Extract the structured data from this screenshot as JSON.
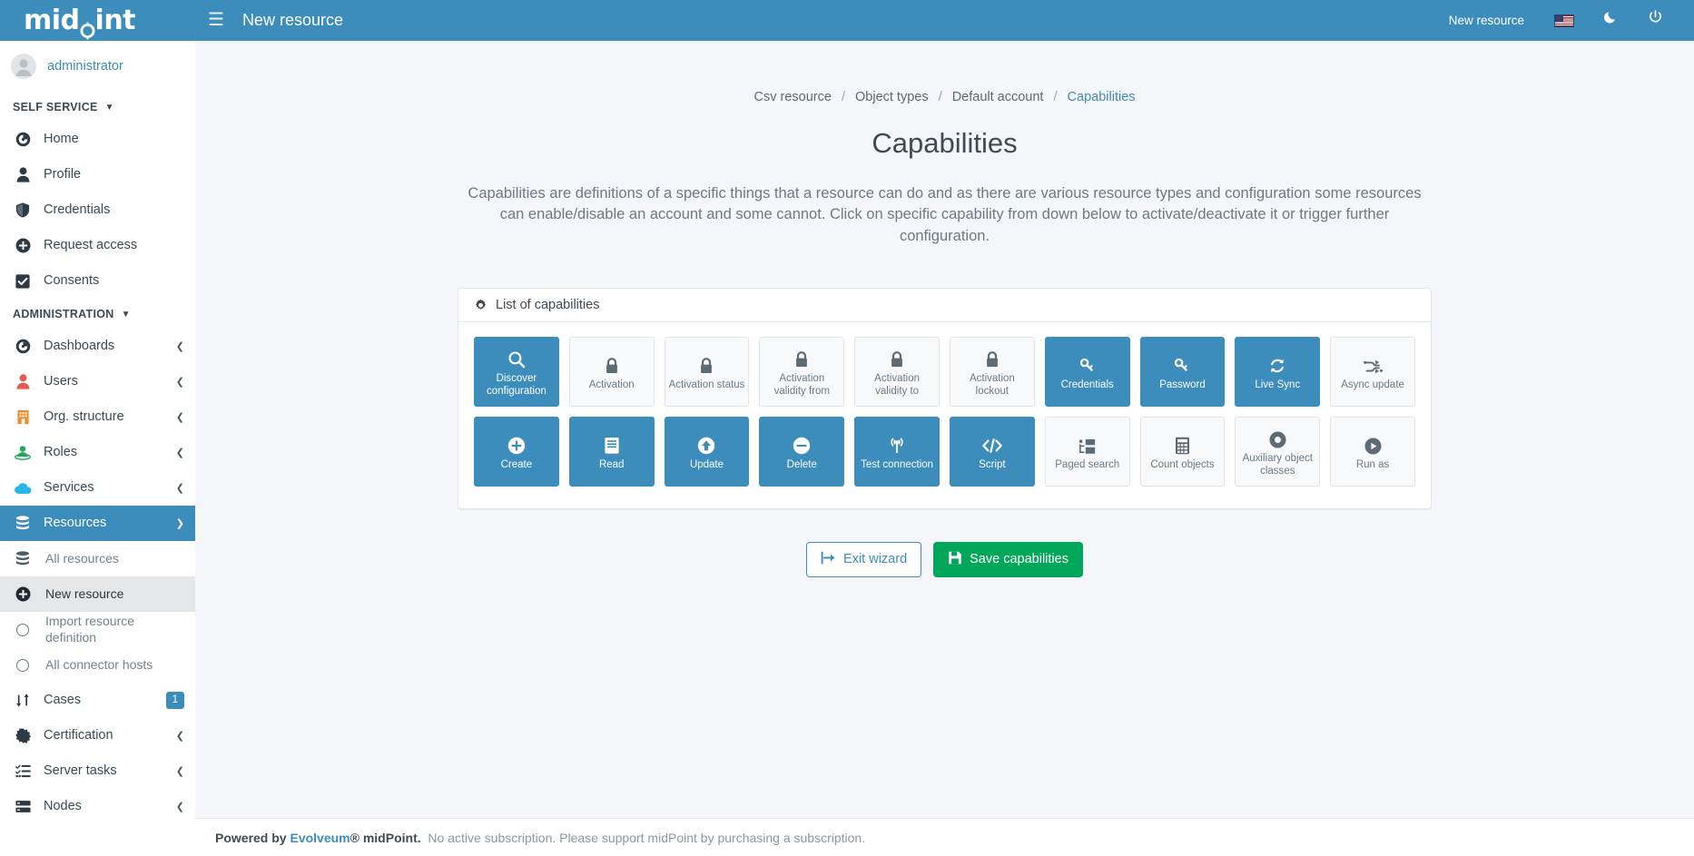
{
  "topbar": {
    "logo_prefix": "mid",
    "logo_p": "P",
    "logo_suffix": "int",
    "hamburger_icon": "hamburger-icon",
    "title": "New resource",
    "right_label": "New resource",
    "flag_icon": "us-flag-icon",
    "theme_icon": "moon-icon",
    "power_icon": "power-icon"
  },
  "sidebar": {
    "user": {
      "name": "administrator",
      "avatar_icon": "user-avatar-icon"
    },
    "sections": [
      {
        "header": "SELF SERVICE",
        "items": [
          {
            "label": "Home",
            "icon": "dashboard-icon",
            "state": "normal"
          },
          {
            "label": "Profile",
            "icon": "person-icon",
            "state": "normal"
          },
          {
            "label": "Credentials",
            "icon": "shield-icon",
            "state": "normal"
          },
          {
            "label": "Request access",
            "icon": "plus-circle-icon",
            "state": "normal"
          },
          {
            "label": "Consents",
            "icon": "check-square-icon",
            "state": "normal"
          }
        ]
      },
      {
        "header": "ADMINISTRATION",
        "items": [
          {
            "label": "Dashboards",
            "icon": "dashboard-icon",
            "state": "normal",
            "chevron": "chevron-left-icon"
          },
          {
            "label": "Users",
            "icon": "users-icon",
            "state": "normal",
            "chevron": "chevron-left-icon"
          },
          {
            "label": "Org. structure",
            "icon": "building-icon",
            "state": "normal",
            "chevron": "chevron-left-icon"
          },
          {
            "label": "Roles",
            "icon": "roles-icon",
            "state": "normal",
            "chevron": "chevron-left-icon"
          },
          {
            "label": "Services",
            "icon": "cloud-icon",
            "state": "normal",
            "chevron": "chevron-left-icon"
          },
          {
            "label": "Resources",
            "icon": "database-icon",
            "state": "active",
            "chevron": "chevron-down-icon"
          },
          {
            "label": "All resources",
            "icon": "database-icon",
            "state": "sub"
          },
          {
            "label": "New resource",
            "icon": "plus-circle-icon",
            "state": "sub-active"
          },
          {
            "label": "Import resource definition",
            "icon": "circle-icon",
            "state": "sub"
          },
          {
            "label": "All connector hosts",
            "icon": "circle-icon",
            "state": "sub"
          },
          {
            "label": "Cases",
            "icon": "cases-icon",
            "state": "normal",
            "badge": "1"
          },
          {
            "label": "Certification",
            "icon": "certification-icon",
            "state": "normal",
            "chevron": "chevron-left-icon"
          },
          {
            "label": "Server tasks",
            "icon": "tasks-list-icon",
            "state": "normal",
            "chevron": "chevron-left-icon"
          },
          {
            "label": "Nodes",
            "icon": "server-icon",
            "state": "normal",
            "chevron": "chevron-left-icon"
          }
        ]
      }
    ]
  },
  "main": {
    "breadcrumb": [
      {
        "label": "Csv resource",
        "current": false
      },
      {
        "label": "Object types",
        "current": false
      },
      {
        "label": "Default account",
        "current": false
      },
      {
        "label": "Capabilities",
        "current": true
      }
    ],
    "breadcrumb_separator": "/",
    "title": "Capabilities",
    "description": "Capabilities are definitions of a specific things that a resource can do and as there are various resource types and configuration some resources can enable/disable an account and some cannot. Click on specific capability from down below to activate/deactivate it or trigger further configuration.",
    "card": {
      "header": "List of capabilities",
      "header_icon": "gear-icon",
      "rows": [
        [
          {
            "label": "Discover configuration",
            "icon": "search-icon",
            "enabled": true
          },
          {
            "label": "Activation",
            "icon": "lock-icon",
            "enabled": false
          },
          {
            "label": "Activation status",
            "icon": "lock-icon",
            "enabled": false
          },
          {
            "label": "Activation validity from",
            "icon": "lock-icon",
            "enabled": false
          },
          {
            "label": "Activation validity to",
            "icon": "lock-icon",
            "enabled": false
          },
          {
            "label": "Activation lockout",
            "icon": "lock-icon",
            "enabled": false
          },
          {
            "label": "Credentials",
            "icon": "key-icon",
            "enabled": true
          },
          {
            "label": "Password",
            "icon": "key-icon",
            "enabled": true
          },
          {
            "label": "Live Sync",
            "icon": "refresh-icon",
            "enabled": true
          },
          {
            "label": "Async update",
            "icon": "shuffle-icon",
            "enabled": false
          }
        ],
        [
          {
            "label": "Create",
            "icon": "plus-circle-icon",
            "enabled": true
          },
          {
            "label": "Read",
            "icon": "book-icon",
            "enabled": true
          },
          {
            "label": "Update",
            "icon": "arrow-up-circle-icon",
            "enabled": true
          },
          {
            "label": "Delete",
            "icon": "minus-circle-icon",
            "enabled": true
          },
          {
            "label": "Test connection",
            "icon": "broadcast-tower-icon",
            "enabled": true
          },
          {
            "label": "Script",
            "icon": "code-icon",
            "enabled": true
          },
          {
            "label": "Paged search",
            "icon": "sitemap-icon",
            "enabled": false
          },
          {
            "label": "Count objects",
            "icon": "calculator-icon",
            "enabled": false
          },
          {
            "label": "Auxiliary object classes",
            "icon": "circle-dot-icon",
            "enabled": false
          },
          {
            "label": "Run as",
            "icon": "play-circle-icon",
            "enabled": false
          }
        ]
      ]
    },
    "actions": {
      "exit_label": "Exit wizard",
      "exit_icon": "sign-out-icon",
      "save_label": "Save capabilities",
      "save_icon": "save-icon"
    }
  },
  "footer": {
    "powered_by": "Powered by",
    "evolveum": "Evolveum",
    "registered": "®",
    "midpoint": "midPoint.",
    "notice": "No active subscription. Please support midPoint by purchasing a subscription."
  },
  "colors": {
    "brand_blue": "#3c8dbc",
    "green": "#00a65a",
    "tile_off_bg": "#f8f9fa",
    "text_muted": "#6b7a85"
  }
}
